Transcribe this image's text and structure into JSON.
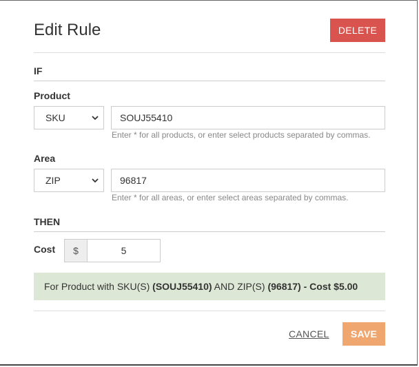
{
  "dialog": {
    "title": "Edit Rule",
    "delete_label": "DELETE",
    "cancel_label": "CANCEL",
    "save_label": "SAVE"
  },
  "if_section": {
    "label": "IF",
    "product": {
      "label": "Product",
      "type_selected": "SKU",
      "value": "SOUJ55410",
      "help": "Enter * for all products, or enter select products separated by commas."
    },
    "area": {
      "label": "Area",
      "type_selected": "ZIP",
      "value": "96817",
      "help": "Enter * for all areas, or enter select areas separated by commas."
    }
  },
  "then_section": {
    "label": "THEN",
    "cost": {
      "label": "Cost",
      "currency_symbol": "$",
      "value": "5"
    }
  },
  "summary": {
    "prefix": "For Product with SKU(S) ",
    "sku": "(SOUJ55410)",
    "middle": " AND ZIP(S) ",
    "zip": "(96817)",
    "cost": " - Cost $5.00"
  },
  "colors": {
    "delete": "#d9534f",
    "save": "#f0a66f",
    "summary_bg": "#dde7d5"
  }
}
